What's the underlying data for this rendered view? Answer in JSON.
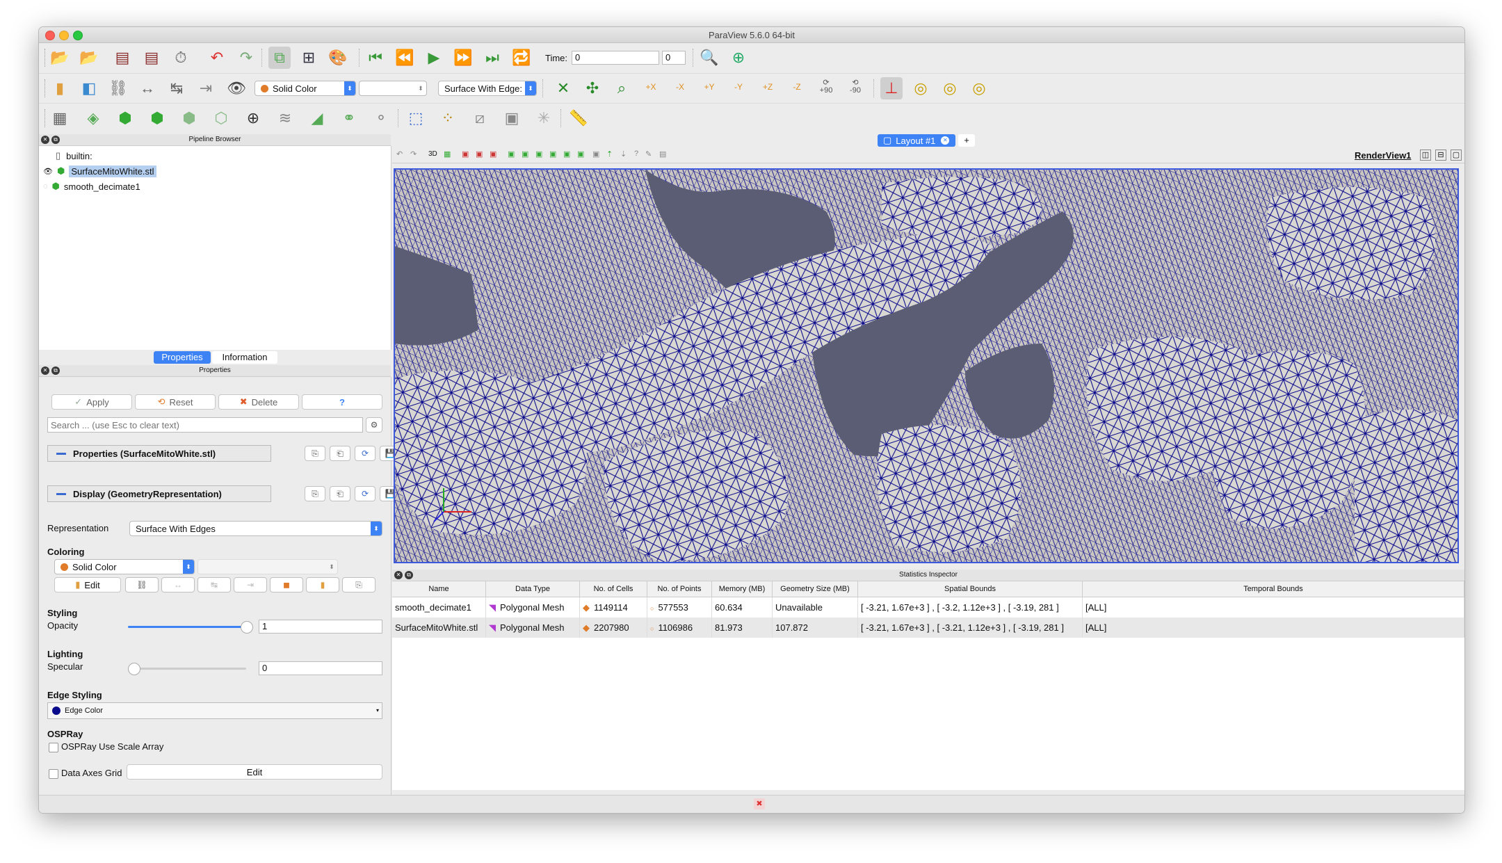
{
  "window": {
    "title": "ParaView 5.6.0 64-bit"
  },
  "toolbar": {
    "time_label": "Time:",
    "time_value": "0",
    "time_step": "0",
    "color_mode": "Solid Color",
    "color_component": "",
    "representation": "Surface With Edge:",
    "view_plus90": "+90",
    "view_minus90": "-90",
    "x_plus": "+X",
    "x_minus": "-X",
    "y_plus": "+Y",
    "y_minus": "-Y",
    "z_plus": "+Z",
    "z_minus": "-Z"
  },
  "pipeline": {
    "header": "Pipeline Browser",
    "items": [
      {
        "label": "builtin:"
      },
      {
        "label": "SurfaceMitoWhite.stl"
      },
      {
        "label": "smooth_decimate1"
      }
    ]
  },
  "tabs": {
    "properties": "Properties",
    "information": "Information"
  },
  "properties": {
    "header": "Properties",
    "apply": "Apply",
    "reset": "Reset",
    "delete": "Delete",
    "help": "?",
    "search_placeholder": "Search ... (use Esc to clear text)",
    "section_props": "Properties (SurfaceMitoWhite.stl)",
    "section_display": "Display (GeometryRepresentation)",
    "representation_label": "Representation",
    "representation_value": "Surface With Edges",
    "coloring": "Coloring",
    "coloring_value": "Solid Color",
    "edit": "Edit",
    "styling": "Styling",
    "opacity_label": "Opacity",
    "opacity_value": "1",
    "lighting": "Lighting",
    "specular_label": "Specular",
    "specular_value": "0",
    "edge_styling": "Edge Styling",
    "edge_color": "Edge Color",
    "ospray": "OSPRay",
    "ospray_scale": "OSPRay Use Scale Array",
    "data_axes": "Data Axes Grid",
    "data_axes_edit": "Edit"
  },
  "layout": {
    "tab_label": "Layout #1",
    "add_tab": "+",
    "view_name": "RenderView1",
    "view_3d": "3D"
  },
  "stats": {
    "header": "Statistics Inspector",
    "columns": [
      "Name",
      "Data Type",
      "No. of Cells",
      "No. of Points",
      "Memory (MB)",
      "Geometry Size (MB)",
      "Spatial Bounds",
      "Temporal Bounds"
    ],
    "rows": [
      [
        "smooth_decimate1",
        "Polygonal Mesh",
        "1149114",
        "577553",
        "60.634",
        "Unavailable",
        "[ -3.21, 1.67e+3 ] , [ -3.2, 1.12e+3 ] , [ -3.19, 281 ]",
        "[ALL]"
      ],
      [
        "SurfaceMitoWhite.stl",
        "Polygonal Mesh",
        "2207980",
        "1106986",
        "81.973",
        "107.872",
        "[ -3.21, 1.67e+3 ] , [ -3.21, 1.12e+3 ] , [ -3.19, 281 ]",
        "[ALL]"
      ]
    ]
  },
  "colors": {
    "accent": "#3d83f5",
    "edge": "#0a0a8c",
    "background3d": "#5a5d73",
    "surface": "#d9d7d2",
    "solid_color_swatch": "#e07b2a"
  }
}
